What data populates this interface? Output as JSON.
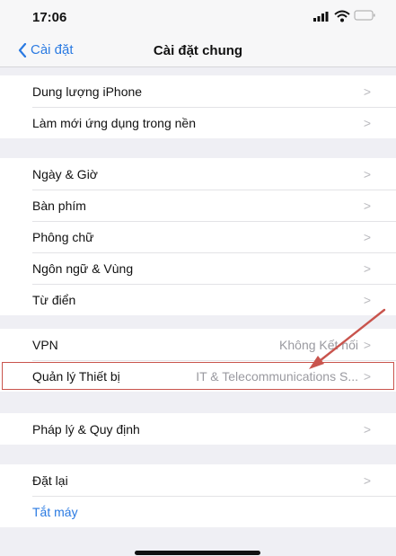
{
  "status": {
    "time": "17:06"
  },
  "nav": {
    "back_label": "Cài đặt",
    "title": "Cài đặt chung"
  },
  "groups": [
    {
      "items": [
        {
          "label": "Dung lượng iPhone"
        },
        {
          "label": "Làm mới ứng dụng trong nền"
        }
      ]
    },
    {
      "items": [
        {
          "label": "Ngày & Giờ"
        },
        {
          "label": "Bàn phím"
        },
        {
          "label": "Phông chữ"
        },
        {
          "label": "Ngôn ngữ & Vùng"
        },
        {
          "label": "Từ điển"
        }
      ]
    },
    {
      "items": [
        {
          "label": "VPN",
          "value": "Không Kết nối"
        },
        {
          "label": "Quản lý Thiết bị",
          "value": "IT & Telecommunications S..."
        }
      ]
    },
    {
      "items": [
        {
          "label": "Pháp lý & Quy định"
        }
      ]
    },
    {
      "items": [
        {
          "label": "Đặt lại"
        },
        {
          "label": "Tắt máy"
        }
      ]
    }
  ],
  "chevron": ">",
  "colors": {
    "accent": "#2a7ae2",
    "annotation": "#c9544d"
  },
  "icons": [
    "chevron-left-icon",
    "signal-icon",
    "wifi-icon",
    "battery-icon",
    "chevron-right-icon",
    "arrow-annotation"
  ]
}
